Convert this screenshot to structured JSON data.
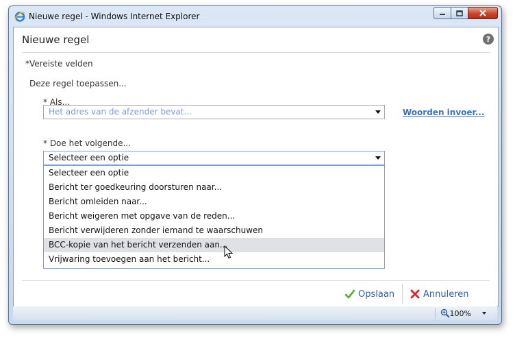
{
  "window": {
    "title": "Nieuwe regel - Windows Internet Explorer",
    "controls": {
      "minimize": "minimize-icon",
      "maximize": "maximize-icon",
      "close": "close-icon"
    }
  },
  "dialog": {
    "title": "Nieuwe regel",
    "help_icon": "help-icon",
    "help_glyph": "?",
    "required_note": "*Vereiste velden",
    "apply_label": "Deze regel toepassen...",
    "if_label": "* Als...",
    "if_select": {
      "value": "Het adres van de afzender bevat..."
    },
    "words_link": "Woorden invoer...",
    "do_label": "* Doe het volgende...",
    "do_select": {
      "value": "Selecteer een optie",
      "options": [
        "Selecteer een optie",
        "Bericht ter goedkeuring doorsturen naar...",
        "Bericht omleiden naar...",
        "Bericht weigeren met opgave van de reden...",
        "Bericht verwijderen zonder iemand te waarschuwen",
        "BCC-kopie van het bericht verzenden aan...",
        "Vrijwaring toevoegen aan het bericht..."
      ],
      "hovered_option": "BCC-kopie van het bericht verzenden aan..."
    },
    "buttons": {
      "save": "Opslaan",
      "cancel": "Annuleren"
    }
  },
  "statusbar": {
    "zoom": "100%"
  },
  "colors": {
    "link": "#3b72c7",
    "placeholder": "#7a9fd4",
    "save_check": "#4caf2a",
    "cancel_x": "#d42a2a",
    "hover_row": "#dfe1e5"
  }
}
